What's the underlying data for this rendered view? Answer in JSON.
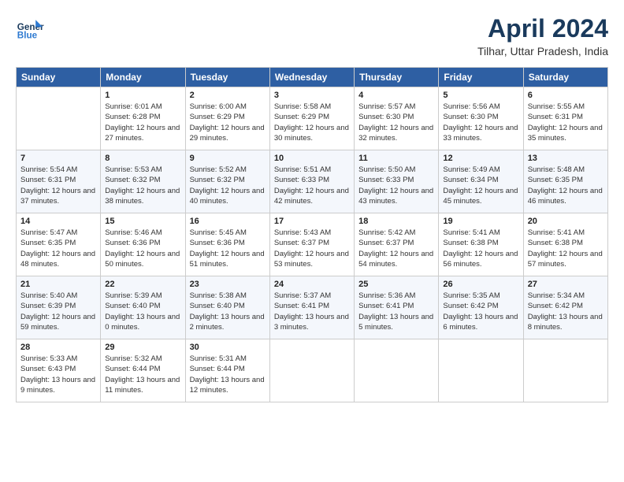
{
  "header": {
    "logo_line1": "General",
    "logo_line2": "Blue",
    "month": "April 2024",
    "location": "Tilhar, Uttar Pradesh, India"
  },
  "weekdays": [
    "Sunday",
    "Monday",
    "Tuesday",
    "Wednesday",
    "Thursday",
    "Friday",
    "Saturday"
  ],
  "weeks": [
    [
      {
        "day": "",
        "empty": true
      },
      {
        "day": "1",
        "sunrise": "6:01 AM",
        "sunset": "6:28 PM",
        "daylight": "12 hours and 27 minutes."
      },
      {
        "day": "2",
        "sunrise": "6:00 AM",
        "sunset": "6:29 PM",
        "daylight": "12 hours and 29 minutes."
      },
      {
        "day": "3",
        "sunrise": "5:58 AM",
        "sunset": "6:29 PM",
        "daylight": "12 hours and 30 minutes."
      },
      {
        "day": "4",
        "sunrise": "5:57 AM",
        "sunset": "6:30 PM",
        "daylight": "12 hours and 32 minutes."
      },
      {
        "day": "5",
        "sunrise": "5:56 AM",
        "sunset": "6:30 PM",
        "daylight": "12 hours and 33 minutes."
      },
      {
        "day": "6",
        "sunrise": "5:55 AM",
        "sunset": "6:31 PM",
        "daylight": "12 hours and 35 minutes."
      }
    ],
    [
      {
        "day": "7",
        "sunrise": "5:54 AM",
        "sunset": "6:31 PM",
        "daylight": "12 hours and 37 minutes."
      },
      {
        "day": "8",
        "sunrise": "5:53 AM",
        "sunset": "6:32 PM",
        "daylight": "12 hours and 38 minutes."
      },
      {
        "day": "9",
        "sunrise": "5:52 AM",
        "sunset": "6:32 PM",
        "daylight": "12 hours and 40 minutes."
      },
      {
        "day": "10",
        "sunrise": "5:51 AM",
        "sunset": "6:33 PM",
        "daylight": "12 hours and 42 minutes."
      },
      {
        "day": "11",
        "sunrise": "5:50 AM",
        "sunset": "6:33 PM",
        "daylight": "12 hours and 43 minutes."
      },
      {
        "day": "12",
        "sunrise": "5:49 AM",
        "sunset": "6:34 PM",
        "daylight": "12 hours and 45 minutes."
      },
      {
        "day": "13",
        "sunrise": "5:48 AM",
        "sunset": "6:35 PM",
        "daylight": "12 hours and 46 minutes."
      }
    ],
    [
      {
        "day": "14",
        "sunrise": "5:47 AM",
        "sunset": "6:35 PM",
        "daylight": "12 hours and 48 minutes."
      },
      {
        "day": "15",
        "sunrise": "5:46 AM",
        "sunset": "6:36 PM",
        "daylight": "12 hours and 50 minutes."
      },
      {
        "day": "16",
        "sunrise": "5:45 AM",
        "sunset": "6:36 PM",
        "daylight": "12 hours and 51 minutes."
      },
      {
        "day": "17",
        "sunrise": "5:43 AM",
        "sunset": "6:37 PM",
        "daylight": "12 hours and 53 minutes."
      },
      {
        "day": "18",
        "sunrise": "5:42 AM",
        "sunset": "6:37 PM",
        "daylight": "12 hours and 54 minutes."
      },
      {
        "day": "19",
        "sunrise": "5:41 AM",
        "sunset": "6:38 PM",
        "daylight": "12 hours and 56 minutes."
      },
      {
        "day": "20",
        "sunrise": "5:41 AM",
        "sunset": "6:38 PM",
        "daylight": "12 hours and 57 minutes."
      }
    ],
    [
      {
        "day": "21",
        "sunrise": "5:40 AM",
        "sunset": "6:39 PM",
        "daylight": "12 hours and 59 minutes."
      },
      {
        "day": "22",
        "sunrise": "5:39 AM",
        "sunset": "6:40 PM",
        "daylight": "13 hours and 0 minutes."
      },
      {
        "day": "23",
        "sunrise": "5:38 AM",
        "sunset": "6:40 PM",
        "daylight": "13 hours and 2 minutes."
      },
      {
        "day": "24",
        "sunrise": "5:37 AM",
        "sunset": "6:41 PM",
        "daylight": "13 hours and 3 minutes."
      },
      {
        "day": "25",
        "sunrise": "5:36 AM",
        "sunset": "6:41 PM",
        "daylight": "13 hours and 5 minutes."
      },
      {
        "day": "26",
        "sunrise": "5:35 AM",
        "sunset": "6:42 PM",
        "daylight": "13 hours and 6 minutes."
      },
      {
        "day": "27",
        "sunrise": "5:34 AM",
        "sunset": "6:42 PM",
        "daylight": "13 hours and 8 minutes."
      }
    ],
    [
      {
        "day": "28",
        "sunrise": "5:33 AM",
        "sunset": "6:43 PM",
        "daylight": "13 hours and 9 minutes."
      },
      {
        "day": "29",
        "sunrise": "5:32 AM",
        "sunset": "6:44 PM",
        "daylight": "13 hours and 11 minutes."
      },
      {
        "day": "30",
        "sunrise": "5:31 AM",
        "sunset": "6:44 PM",
        "daylight": "13 hours and 12 minutes."
      },
      {
        "day": "",
        "empty": true
      },
      {
        "day": "",
        "empty": true
      },
      {
        "day": "",
        "empty": true
      },
      {
        "day": "",
        "empty": true
      }
    ]
  ]
}
